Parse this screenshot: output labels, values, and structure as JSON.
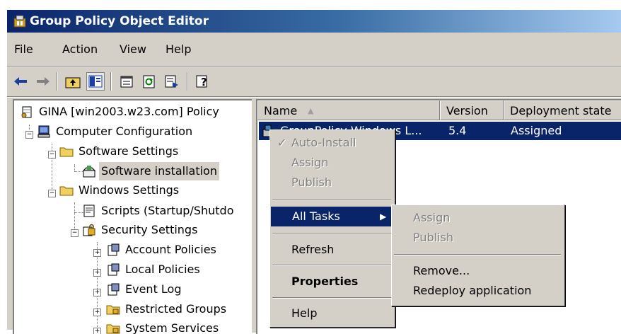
{
  "window": {
    "title": "Group Policy Object Editor",
    "icon": "gpedit-icon"
  },
  "menubar": {
    "items": [
      {
        "label": "File"
      },
      {
        "label": "Action"
      },
      {
        "label": "View"
      },
      {
        "label": "Help"
      }
    ]
  },
  "toolbar": {
    "buttons": [
      "back-icon",
      "forward-icon",
      "up-folder-icon",
      "show-hide-tree-icon",
      "properties-icon",
      "refresh-icon",
      "export-list-icon",
      "help-icon"
    ]
  },
  "tree": {
    "root": "GINA [win2003.w23.com] Policy",
    "computer_config": "Computer Configuration",
    "software_settings": "Software Settings",
    "software_installation": "Software installation",
    "windows_settings": "Windows Settings",
    "scripts": "Scripts (Startup/Shutdo",
    "security_settings": "Security Settings",
    "account_policies": "Account Policies",
    "local_policies": "Local Policies",
    "event_log": "Event Log",
    "restricted_groups": "Restricted Groups",
    "system_services": "System Services"
  },
  "list": {
    "columns": {
      "name": "Name",
      "version": "Version",
      "deployment": "Deployment state"
    },
    "sort_indicator": "▲",
    "rows": [
      {
        "name": "GroupPolicy Windows L...",
        "version": "5.4",
        "deployment": "Assigned"
      }
    ]
  },
  "context_menu": {
    "auto_install": "Auto-Install",
    "assign": "Assign",
    "publish": "Publish",
    "all_tasks": "All Tasks",
    "refresh": "Refresh",
    "properties": "Properties",
    "help": "Help"
  },
  "submenu": {
    "assign": "Assign",
    "publish": "Publish",
    "remove": "Remove...",
    "redeploy": "Redeploy application"
  }
}
